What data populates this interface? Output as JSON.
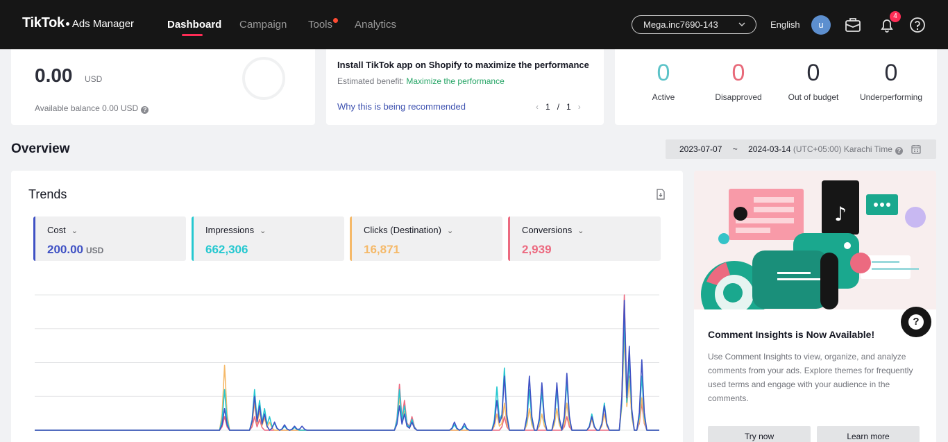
{
  "nav": {
    "brand": "TikTok",
    "product": "Ads Manager",
    "items": [
      {
        "label": "Dashboard",
        "active": true
      },
      {
        "label": "Campaign",
        "active": false
      },
      {
        "label": "Tools",
        "active": false,
        "has_dot": true
      },
      {
        "label": "Analytics",
        "active": false
      }
    ],
    "account": "Mega.inc7690-143",
    "language": "English",
    "avatar_initial": "u",
    "notification_count": "4"
  },
  "balance": {
    "amount": "0.00",
    "currency": "USD",
    "available": "Available balance 0.00 USD"
  },
  "recommendation": {
    "title": "Install TikTok app on Shopify to maximize the performance",
    "benefit_label": "Estimated benefit: ",
    "benefit_value": "Maximize the performance",
    "why_link": "Why this is being recommended",
    "page_current": "1",
    "page_sep": "/",
    "page_total": "1"
  },
  "status": [
    {
      "value": "0",
      "label": "Active",
      "color": "#5cc3c8"
    },
    {
      "value": "0",
      "label": "Disapproved",
      "color": "#e86a7a"
    },
    {
      "value": "0",
      "label": "Out of budget",
      "color": "#2d2f3a"
    },
    {
      "value": "0",
      "label": "Underperforming",
      "color": "#2d2f3a"
    }
  ],
  "overview": {
    "title": "Overview",
    "date_start": "2023-07-07",
    "date_sep": "~",
    "date_end": "2024-03-14",
    "timezone": "(UTC+05:00) Karachi Time"
  },
  "trends": {
    "title": "Trends",
    "metrics": [
      {
        "label": "Cost",
        "value": "200.00",
        "unit": "USD",
        "color": "#3f51c4"
      },
      {
        "label": "Impressions",
        "value": "662,306",
        "unit": "",
        "color": "#25c8d0"
      },
      {
        "label": "Clicks (Destination)",
        "value": "16,871",
        "unit": "",
        "color": "#f5b969"
      },
      {
        "label": "Conversions",
        "value": "2,939",
        "unit": "",
        "color": "#ec6a80"
      }
    ]
  },
  "chart_data": {
    "type": "line",
    "title": "",
    "xlabel": "",
    "ylabel": "",
    "grid": true,
    "x": [
      0,
      1,
      2,
      3,
      4,
      5,
      6,
      7,
      8,
      9,
      10,
      11,
      12,
      13,
      14,
      15,
      16,
      17,
      18,
      19,
      20,
      21,
      22,
      23,
      24,
      25,
      26,
      27,
      28,
      29,
      30,
      31,
      32,
      33,
      34,
      35,
      36,
      37,
      38,
      39,
      40,
      41,
      42,
      43,
      44,
      45,
      46,
      47,
      48,
      49,
      50,
      51,
      52,
      53,
      54,
      55,
      56,
      57,
      58,
      59,
      60,
      61,
      62,
      63,
      64,
      65,
      66,
      67,
      68,
      69,
      70,
      71,
      72,
      73,
      74,
      75,
      76,
      77,
      78,
      79,
      80,
      81,
      82,
      83,
      84,
      85,
      86,
      87,
      88,
      89,
      90,
      91,
      92,
      93,
      94,
      95,
      96,
      97,
      98,
      99,
      100,
      101,
      102,
      103,
      104,
      105,
      106,
      107,
      108,
      109,
      110,
      111,
      112,
      113,
      114,
      115,
      116,
      117,
      118,
      119,
      120,
      121,
      122,
      123,
      124,
      125,
      126,
      127,
      128,
      129,
      130,
      131,
      132,
      133,
      134,
      135,
      136,
      137,
      138,
      139,
      140,
      141,
      142,
      143,
      144,
      145,
      146,
      147,
      148,
      149,
      150,
      151,
      152,
      153,
      154,
      155,
      156,
      157,
      158,
      159,
      160,
      161,
      162,
      163,
      164,
      165,
      166,
      167,
      168,
      169,
      170,
      171,
      172,
      173,
      174,
      175,
      176,
      177,
      178,
      179,
      180,
      181,
      182,
      183,
      184,
      185,
      186,
      187,
      188,
      189,
      190,
      191,
      192,
      193,
      194,
      195,
      196,
      197,
      198,
      199,
      200,
      201,
      202,
      203,
      204,
      205,
      206,
      207,
      208,
      209,
      210,
      211,
      212,
      213,
      214,
      215,
      216,
      217,
      218,
      219,
      220,
      221,
      222,
      223,
      224,
      225,
      226,
      227,
      228,
      229,
      230,
      231,
      232,
      233,
      234,
      235,
      236,
      237,
      238,
      239,
      240,
      241,
      242,
      243,
      244,
      245,
      246,
      247,
      248,
      249,
      250
    ],
    "ylim": [
      0,
      100
    ],
    "series": [
      {
        "color": "#3f51c4",
        "peaks": [
          [
            79,
            16
          ],
          [
            92,
            25
          ],
          [
            94,
            18
          ],
          [
            96,
            12
          ],
          [
            100,
            6
          ],
          [
            104,
            4
          ],
          [
            108,
            3
          ],
          [
            111,
            3
          ],
          [
            152,
            18
          ],
          [
            154,
            12
          ],
          [
            157,
            6
          ],
          [
            175,
            6
          ],
          [
            179,
            5
          ],
          [
            192,
            22
          ],
          [
            196,
            40
          ],
          [
            206,
            40
          ],
          [
            211,
            35
          ],
          [
            217,
            35
          ],
          [
            222,
            42
          ],
          [
            232,
            10
          ],
          [
            237,
            18
          ],
          [
            245,
            96
          ],
          [
            248,
            62
          ],
          [
            253,
            52
          ]
        ]
      },
      {
        "color": "#25c8d0",
        "peaks": [
          [
            79,
            30
          ],
          [
            92,
            30
          ],
          [
            94,
            22
          ],
          [
            96,
            16
          ],
          [
            98,
            10
          ],
          [
            100,
            5
          ],
          [
            104,
            3
          ],
          [
            108,
            2
          ],
          [
            152,
            30
          ],
          [
            154,
            18
          ],
          [
            157,
            8
          ],
          [
            175,
            4
          ],
          [
            179,
            3
          ],
          [
            192,
            32
          ],
          [
            196,
            46
          ],
          [
            206,
            30
          ],
          [
            211,
            28
          ],
          [
            217,
            30
          ],
          [
            222,
            36
          ],
          [
            232,
            12
          ],
          [
            237,
            20
          ],
          [
            245,
            82
          ],
          [
            248,
            52
          ],
          [
            253,
            40
          ]
        ]
      },
      {
        "color": "#f5b969",
        "peaks": [
          [
            79,
            48
          ],
          [
            92,
            20
          ],
          [
            94,
            14
          ],
          [
            96,
            9
          ],
          [
            98,
            6
          ],
          [
            152,
            25
          ],
          [
            154,
            14
          ],
          [
            157,
            6
          ],
          [
            192,
            12
          ],
          [
            196,
            20
          ],
          [
            206,
            16
          ],
          [
            211,
            12
          ],
          [
            217,
            16
          ],
          [
            222,
            20
          ],
          [
            232,
            8
          ],
          [
            237,
            12
          ],
          [
            245,
            70
          ],
          [
            248,
            38
          ],
          [
            253,
            24
          ]
        ]
      },
      {
        "color": "#ec6a80",
        "peaks": [
          [
            79,
            10
          ],
          [
            92,
            10
          ],
          [
            94,
            8
          ],
          [
            152,
            34
          ],
          [
            154,
            22
          ],
          [
            157,
            10
          ],
          [
            196,
            10
          ],
          [
            222,
            10
          ],
          [
            245,
            100
          ],
          [
            248,
            40
          ],
          [
            253,
            20
          ]
        ]
      }
    ]
  },
  "promo": {
    "title": "Comment Insights is Now Available!",
    "description": "Use Comment Insights to view, organize, and analyze comments from your ads. Explore themes for frequently used terms and engage with your audience in the comments.",
    "try_label": "Try now",
    "learn_label": "Learn more"
  },
  "help_label": "?"
}
